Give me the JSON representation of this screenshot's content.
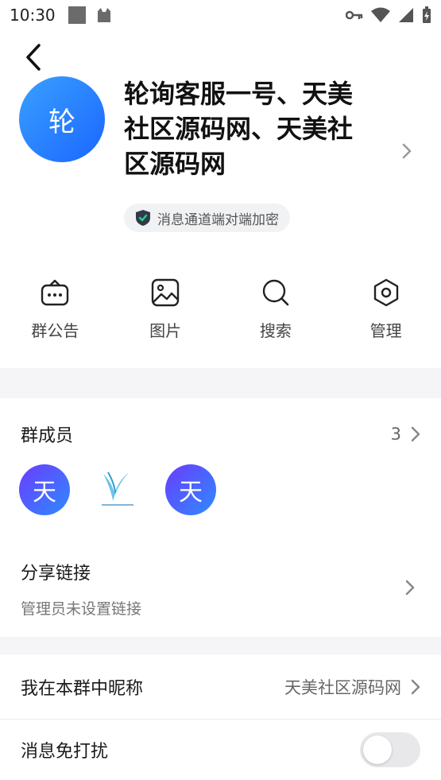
{
  "status_bar": {
    "time": "10:30"
  },
  "header": {
    "avatar_char": "轮",
    "group_name": "轮询客服一号、天美社区源码网、天美社区源码网",
    "encryption_text": "消息通道端对端加密"
  },
  "actions": [
    {
      "label": "群公告",
      "icon": "announcement-icon"
    },
    {
      "label": "图片",
      "icon": "image-icon"
    },
    {
      "label": "搜索",
      "icon": "search-icon"
    },
    {
      "label": "管理",
      "icon": "settings-hex-icon"
    }
  ],
  "members": {
    "title": "群成员",
    "count": "3",
    "avatars": [
      "天",
      "logo",
      "天"
    ]
  },
  "share": {
    "title": "分享链接",
    "subtitle": "管理员未设置链接"
  },
  "nickname": {
    "title": "我在本群中昵称",
    "value": "天美社区源码网"
  },
  "dnd": {
    "title": "消息免打扰",
    "enabled": false
  },
  "colors": {
    "accent": "#1a66ff",
    "band": "#f5f5f7"
  }
}
